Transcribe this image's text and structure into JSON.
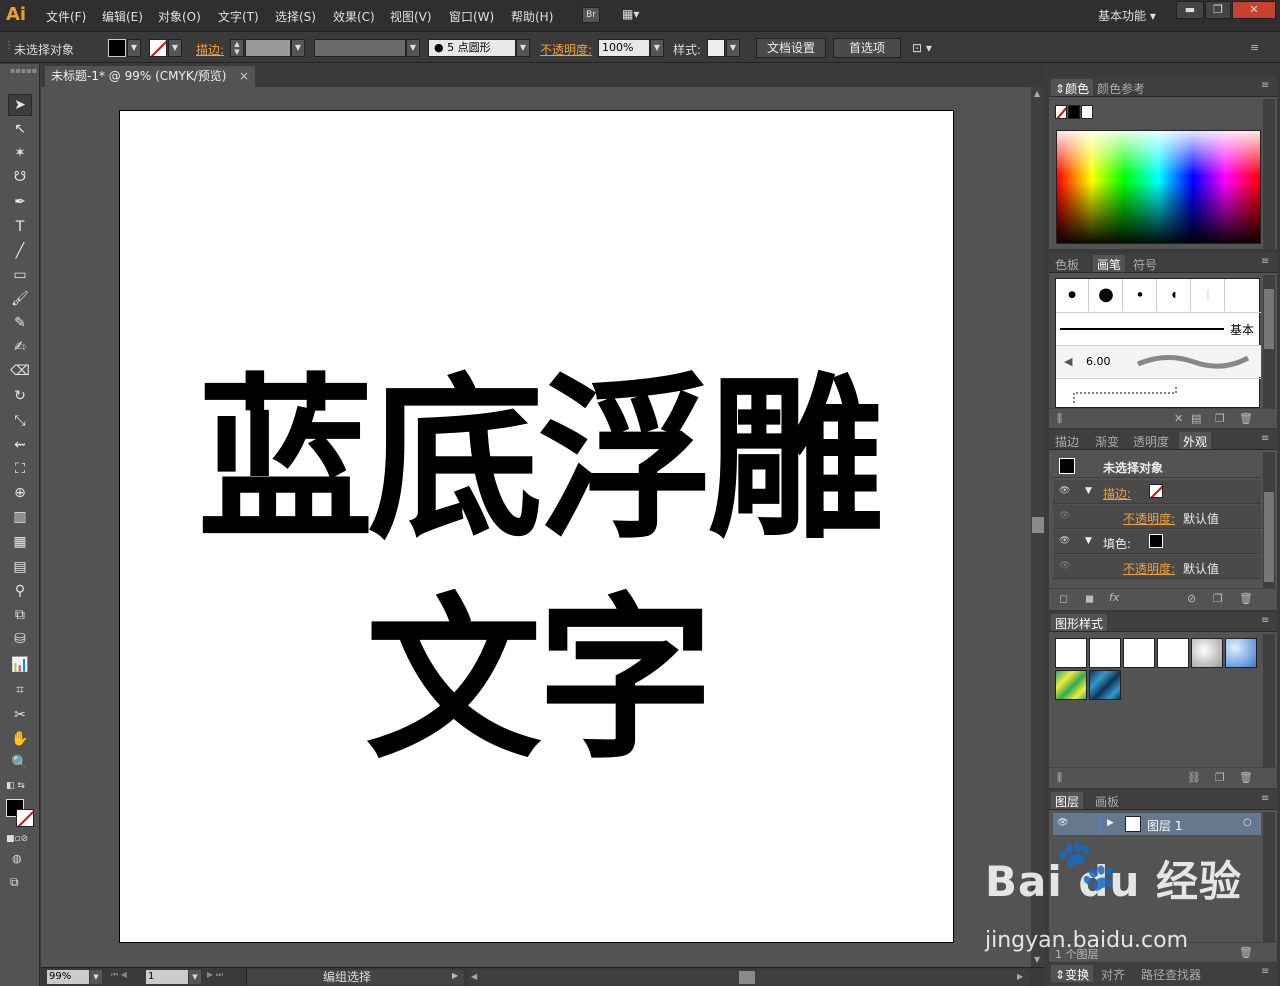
{
  "app": {
    "logo": "Ai",
    "workspace": "基本功能"
  },
  "menu": [
    "文件(F)",
    "编辑(E)",
    "对象(O)",
    "文字(T)",
    "选择(S)",
    "效果(C)",
    "视图(V)",
    "窗口(W)",
    "帮助(H)"
  ],
  "menu_extra": {
    "bridge": "Br"
  },
  "control": {
    "selection": "未选择对象",
    "stroke_label": "描边:",
    "brush_size": "5",
    "brush_name": "点圆形",
    "opacity_label": "不透明度:",
    "opacity_value": "100%",
    "style_label": "样式:",
    "doc_setup": "文档设置",
    "prefs": "首选项"
  },
  "document": {
    "tab_title": "未标题-1* @ 99% (CMYK/预览)",
    "text_line1": "蓝底浮雕",
    "text_line2": "文字"
  },
  "status": {
    "zoom": "99%",
    "page": "1",
    "mode": "编组选择"
  },
  "panels": {
    "color": {
      "tabs": [
        "颜色",
        "颜色参考"
      ]
    },
    "brush": {
      "tabs": [
        "色板",
        "画笔",
        "符号"
      ],
      "basic": "基本",
      "size": "6.00"
    },
    "appearance": {
      "tabs": [
        "描边",
        "渐变",
        "透明度",
        "外观"
      ],
      "header": "未选择对象",
      "stroke": "描边:",
      "opacity": "不透明度:",
      "default": "默认值",
      "fill": "填色:",
      "fx": "fx"
    },
    "graphic_styles": {
      "tabs": [
        "图形样式"
      ]
    },
    "layers": {
      "tabs": [
        "图层",
        "画板"
      ],
      "layer_name": "图层 1",
      "count": "1 个图层"
    },
    "bottom": {
      "tabs": [
        "变换",
        "对齐",
        "路径查找器"
      ]
    }
  },
  "watermark": {
    "brand": "Bai du 经验",
    "url": "jingyan.baidu.com"
  }
}
